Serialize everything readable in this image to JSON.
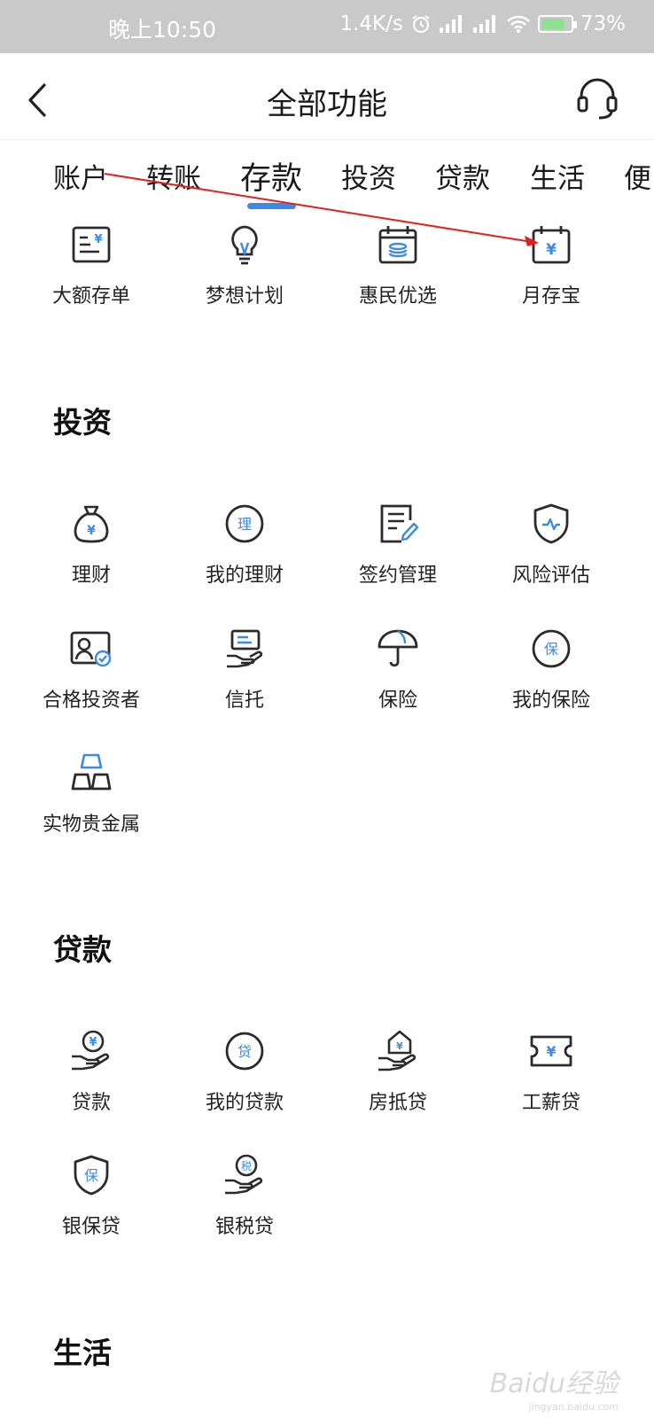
{
  "status": {
    "time": "晚上10:50",
    "speed": "1.4K/s",
    "battery": "73%",
    "battery_level": 0.73
  },
  "header": {
    "title": "全部功能",
    "back_icon": "chevron-left-icon",
    "support_icon": "headset-icon"
  },
  "tabs": [
    "账户",
    "转账",
    "存款",
    "投资",
    "贷款",
    "生活",
    "便"
  ],
  "deposit": {
    "items": [
      {
        "label": "大额存单",
        "icon": "certificate-yen-icon"
      },
      {
        "label": "梦想计划",
        "icon": "lightbulb-icon"
      },
      {
        "label": "惠民优选",
        "icon": "calendar-coins-icon"
      },
      {
        "label": "月存宝",
        "icon": "calendar-yen-icon"
      }
    ]
  },
  "investment": {
    "title": "投资",
    "items": [
      {
        "label": "理财",
        "icon": "money-bag-icon"
      },
      {
        "label": "我的理财",
        "icon": "circle-li-icon",
        "glyph": "理"
      },
      {
        "label": "签约管理",
        "icon": "document-pen-icon"
      },
      {
        "label": "风险评估",
        "icon": "shield-pulse-icon"
      },
      {
        "label": "合格投资者",
        "icon": "id-card-check-icon"
      },
      {
        "label": "信托",
        "icon": "hand-card-icon"
      },
      {
        "label": "保险",
        "icon": "umbrella-icon"
      },
      {
        "label": "我的保险",
        "icon": "circle-bao-icon",
        "glyph": "保"
      },
      {
        "label": "实物贵金属",
        "icon": "gold-bars-icon"
      }
    ]
  },
  "loans": {
    "title": "贷款",
    "items": [
      {
        "label": "贷款",
        "icon": "hand-yen-coin-icon"
      },
      {
        "label": "我的贷款",
        "icon": "circle-dai-icon",
        "glyph": "贷"
      },
      {
        "label": "房抵贷",
        "icon": "hand-house-icon"
      },
      {
        "label": "工薪贷",
        "icon": "ticket-yen-icon"
      },
      {
        "label": "银保贷",
        "icon": "shield-bao-icon",
        "glyph": "保"
      },
      {
        "label": "银税贷",
        "icon": "hand-tax-coin-icon",
        "glyph": "税"
      }
    ]
  },
  "life": {
    "title": "生活"
  },
  "watermark": {
    "text": "Baidu经验",
    "sub": "jingyan.baidu.com"
  },
  "colors": {
    "accent": "#3c8ae6",
    "icon_stroke": "#2b2b2b",
    "annotation": "#e02020"
  }
}
